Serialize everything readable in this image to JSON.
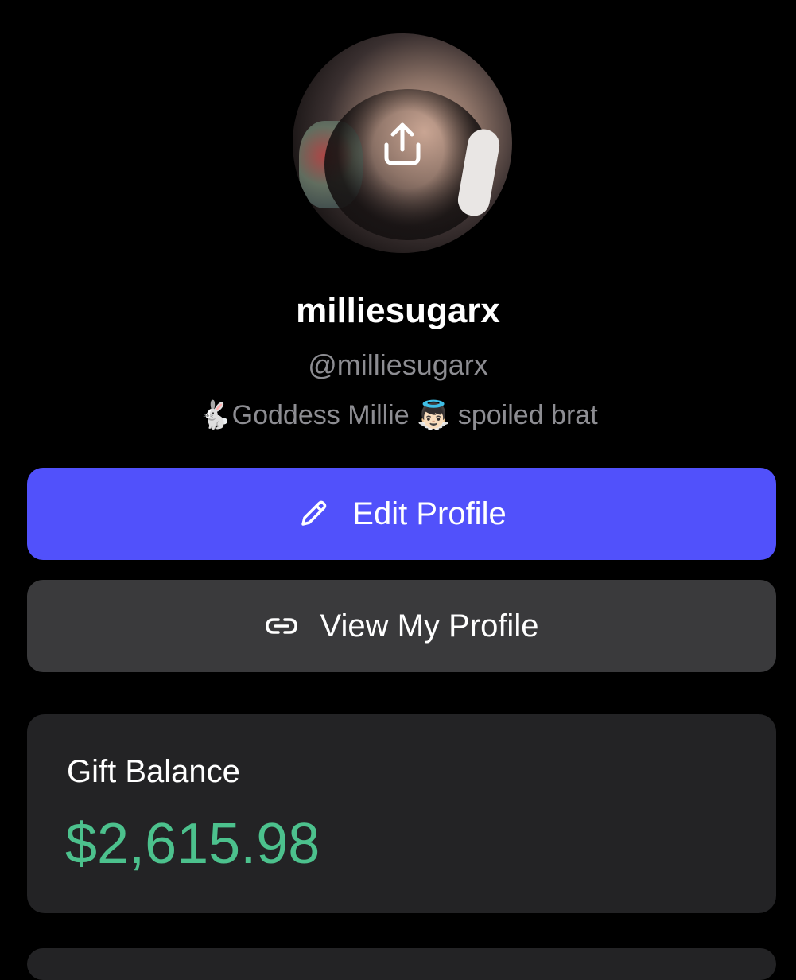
{
  "profile": {
    "display_name": "milliesugarx",
    "handle": "@milliesugarx",
    "bio": "🐇Goddess Millie 👼🏻 spoiled brat",
    "avatar_overlay_icon": "upload-icon"
  },
  "actions": {
    "edit_profile_label": "Edit Profile",
    "edit_profile_icon": "pencil-icon",
    "view_profile_label": "View My Profile",
    "view_profile_icon": "link-icon"
  },
  "gift_balance": {
    "label": "Gift Balance",
    "amount": "$2,615.98",
    "amount_color": "#4cc18d"
  },
  "colors": {
    "background": "#000000",
    "primary_button": "#5151fb",
    "secondary_button": "#3a3a3c",
    "card": "#232325",
    "muted_text": "#8d8d92"
  }
}
